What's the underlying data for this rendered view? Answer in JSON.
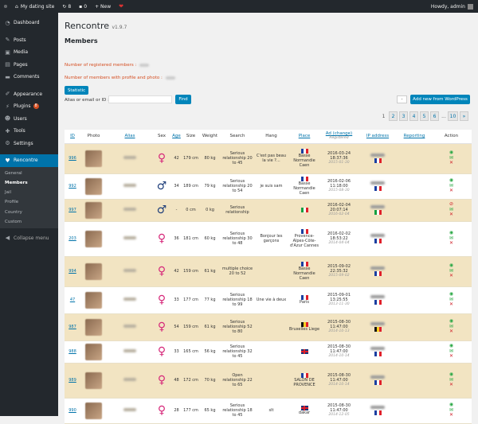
{
  "adminbar": {
    "site_name": "My dating site",
    "updates_count": "8",
    "comments_count": "0",
    "new_label": "+ New",
    "howdy": "Howdy, admin"
  },
  "sidebar": {
    "items": [
      {
        "label": "Dashboard",
        "icon": "dashboard-icon"
      },
      {
        "label": "Posts",
        "icon": "pin-icon"
      },
      {
        "label": "Media",
        "icon": "media-icon"
      },
      {
        "label": "Pages",
        "icon": "page-icon"
      },
      {
        "label": "Comments",
        "icon": "comment-icon"
      },
      {
        "label": "Appearance",
        "icon": "brush-icon"
      },
      {
        "label": "Plugins",
        "icon": "plugin-icon",
        "badge": "8"
      },
      {
        "label": "Users",
        "icon": "users-icon"
      },
      {
        "label": "Tools",
        "icon": "wrench-icon"
      },
      {
        "label": "Settings",
        "icon": "settings-icon"
      },
      {
        "label": "Rencontre",
        "icon": "heart-icon",
        "active": true
      }
    ],
    "submenu": [
      "General",
      "Members",
      "Jail",
      "Profile",
      "Country",
      "Custom"
    ],
    "submenu_current": "Members",
    "collapse": "Collapse menu"
  },
  "page": {
    "title": "Rencontre",
    "version": "v1.9.7",
    "section": "Members",
    "registered_label": "Number of registered members :",
    "profile_label": "Number of members with profile and photo :",
    "statistic_button": "Statistic",
    "search_label": "Alias or email or ID :",
    "search_value": "",
    "find_button": "Find",
    "select_value": "-",
    "add_button": "Add new from WordPress",
    "pagination": [
      "1",
      "2",
      "3",
      "4",
      "5",
      "6",
      "...",
      "10",
      "»"
    ]
  },
  "columns": {
    "id": "ID",
    "photo": "Photo",
    "alias": "Alias",
    "sex": "Sex",
    "age": "Age",
    "size": "Size",
    "weight": "Weight",
    "search": "Search",
    "hang": "Hang",
    "place": "Place",
    "ad": "Ad (change)",
    "ad_sub": "Registered",
    "ip": "IP address",
    "reporting": "Reporting",
    "action": "Action"
  },
  "rows": [
    {
      "id": "996",
      "sex": "f",
      "age": "42",
      "size": "179 cm",
      "weight": "80 kg",
      "search": "Serious relationship 20 to 45",
      "hang": "C'est pas beau la vie ?...",
      "place": "Basse Normandie Caen",
      "flag": "fr",
      "ad": "2016-03-24 18:37:36",
      "reg": "2015-01-30",
      "ipflag": "fr",
      "hidden": false
    },
    {
      "id": "992",
      "sex": "m",
      "age": "34",
      "size": "189 cm",
      "weight": "79 kg",
      "search": "Serious relationship 20 to 54",
      "hang": "je suis sam",
      "place": "Basse Normandie Caen",
      "flag": "fr",
      "ad": "2016-02-06 11:18:00",
      "reg": "2015-08-30",
      "ipflag": "fr",
      "hidden": false
    },
    {
      "id": "997",
      "sex": "m",
      "age": "-",
      "size": "0 cm",
      "weight": "0 kg",
      "search": "Serious relationship",
      "hang": "",
      "place": "",
      "flag": "it",
      "ad": "2016-02-04 20:07:14",
      "reg": "2016-02-04",
      "ipflag": "it",
      "hidden": true
    },
    {
      "id": "203",
      "sex": "f",
      "age": "36",
      "size": "181 cm",
      "weight": "60 kg",
      "search": "Serious relationship 30 to 48",
      "hang": "Bonjour les garçons",
      "place": "Provence-Alpes-Côte-d'Azur Cannes",
      "flag": "fr",
      "ad": "2016-02-02 18:53:22",
      "reg": "2014-04-04",
      "ipflag": "fr",
      "hidden": false
    },
    {
      "id": "994",
      "sex": "f",
      "age": "42",
      "size": "159 cm",
      "weight": "61 kg",
      "search": "multiple choice 20 to 52",
      "hang": "",
      "place": "Basse Normandie Caen",
      "flag": "fr",
      "ad": "2015-09-02 22:35:32",
      "reg": "2015-09-02",
      "ipflag": "fr",
      "hidden": false
    },
    {
      "id": "47",
      "sex": "f",
      "age": "33",
      "size": "177 cm",
      "weight": "77 kg",
      "search": "Serious relationship 18 to 99",
      "hang": "Une vie à deux",
      "place": "Paris",
      "flag": "fr",
      "ad": "2015-09-01 13:25:55",
      "reg": "2013-11-30",
      "ipflag": "fr",
      "hidden": false
    },
    {
      "id": "987",
      "sex": "f",
      "age": "54",
      "size": "159 cm",
      "weight": "61 kg",
      "search": "Serious relationship 52 to 80",
      "hang": "",
      "place": "Bruxelles Liege",
      "flag": "be",
      "ad": "2015-08-30 11:47:00",
      "reg": "2014-10-13",
      "ipflag": "be",
      "hidden": false
    },
    {
      "id": "988",
      "sex": "f",
      "age": "33",
      "size": "165 cm",
      "weight": "56 kg",
      "search": "Serious relationship 32 to 45",
      "hang": "",
      "place": "",
      "flag": "uk",
      "ad": "2015-08-30 11:47:00",
      "reg": "2014-10-14",
      "ipflag": "fr",
      "hidden": false
    },
    {
      "id": "989",
      "sex": "f",
      "age": "48",
      "size": "172 cm",
      "weight": "70 kg",
      "search": "Open relationship 22 to 65",
      "hang": "",
      "place": "SALON DE PROVENCE",
      "flag": "fr",
      "ad": "2015-08-30 11:47:00",
      "reg": "2014-10-14",
      "ipflag": "fr",
      "hidden": false
    },
    {
      "id": "990",
      "sex": "f",
      "age": "28",
      "size": "177 cm",
      "weight": "65 kg",
      "search": "Serious relationship 18 to 45",
      "hang": "slt",
      "place": "dakar",
      "flag": "uk",
      "ad": "2015-08-30 11:47:00",
      "reg": "2014-12-05",
      "ipflag": "fr",
      "hidden": false
    }
  ]
}
